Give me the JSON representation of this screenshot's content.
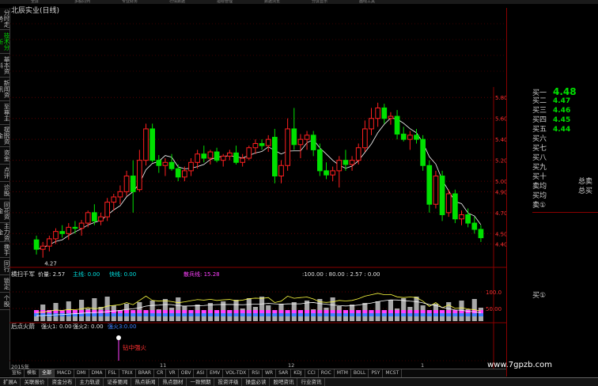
{
  "app": {
    "title": "北辰实业(日线)",
    "top_menu": [
      "全屏",
      "多股同列",
      "专业财务",
      "行情数据",
      "指标管理",
      "数据浏览",
      "分屏显示",
      "画线工具"
    ]
  },
  "left_sidebar": {
    "tabs": [
      {
        "label": "分时走势",
        "active": false
      },
      {
        "label": "技术分析",
        "active": true
      },
      {
        "label": "基本资料",
        "active": false
      },
      {
        "label": "新闻资讯",
        "active": false
      },
      {
        "label": "至尊主",
        "active": false
      },
      {
        "label": "摆脱资金",
        "active": false
      },
      {
        "label": "资金",
        "active": false
      },
      {
        "label": "点评",
        "active": false
      },
      {
        "label": "诊股",
        "active": false
      },
      {
        "label": "同花资金",
        "active": false
      },
      {
        "label": "主力资金",
        "active": false
      },
      {
        "label": "换手",
        "active": false
      },
      {
        "label": "同行",
        "active": false
      },
      {
        "label": "锁定",
        "active": false
      },
      {
        "label": "个股",
        "active": false
      }
    ]
  },
  "indicator_bar_1": {
    "name": "横扫千军",
    "fields": [
      "价量: 2.57",
      "主线: 0.00",
      "快线: 0.00",
      "散兵线: 15.28",
      ":100.00 : 80.00 : 2.57 : 0.00"
    ]
  },
  "indicator_bar_2": {
    "name": "后点火箭",
    "fields": [
      "强火1: 0.00",
      "强火2: 0.00",
      "强火3:0.00"
    ]
  },
  "annotations": {
    "low_price": "4.27",
    "signal_label": "钻中强火"
  },
  "price_axis": [
    "5.80",
    "5.60",
    "5.40",
    "5.20",
    "5.00",
    "4.90",
    "4.70",
    "4.50",
    "4.40"
  ],
  "sub_axis": [
    "100.0",
    "50.00"
  ],
  "right_panel": {
    "quotes": [
      {
        "label": "买一",
        "value": "4.48"
      },
      {
        "label": "买二",
        "value": "4.47"
      },
      {
        "label": "买三",
        "value": "4.46"
      },
      {
        "label": "买四",
        "value": "4.45"
      },
      {
        "label": "买五",
        "value": "4.44"
      },
      {
        "label": "买六",
        "value": ""
      },
      {
        "label": "买七",
        "value": ""
      },
      {
        "label": "买八",
        "value": ""
      },
      {
        "label": "买九",
        "value": ""
      },
      {
        "label": "买十",
        "value": ""
      },
      {
        "label": "卖均",
        "value": ""
      },
      {
        "label": "买均",
        "value": ""
      },
      {
        "label": "卖①",
        "value": ""
      }
    ],
    "side_labels": [
      "总卖",
      "总买"
    ],
    "sub_label": "买①"
  },
  "year_labels": [
    "2015年",
    "11",
    "12",
    "1"
  ],
  "bottom_tabs": [
    "宣标",
    "模板",
    "全部",
    "MACD",
    "DMI",
    "DMA",
    "FSL",
    "TRIX",
    "BRAR",
    "CR",
    "VR",
    "OBV",
    "ASI",
    "EMV",
    "VOL-TDX",
    "RSI",
    "WR",
    "SAR",
    "KDJ",
    "CCI",
    "ROC",
    "MTM",
    "BOLL",
    "PSY",
    "MCST"
  ],
  "status_bar": [
    "扩展A",
    "关联报价",
    "资金分布",
    "主力轨迹",
    "证券要闻",
    "热点新闻",
    "热点题材",
    "一致预期",
    "投资评级",
    "操盘必读",
    "股吧资讯",
    "行业资讯"
  ],
  "watermark": "www.7gpzb.com",
  "colors": {
    "up": "#ff2020",
    "down": "#00e000",
    "ma": "#ffffff",
    "grid": "#800000"
  },
  "chart_data": {
    "type": "candlestick",
    "title": "北辰实业(日线)",
    "ylim": [
      4.2,
      5.9
    ],
    "candles": [
      {
        "o": 4.44,
        "h": 4.48,
        "l": 4.3,
        "c": 4.35
      },
      {
        "o": 4.35,
        "h": 4.42,
        "l": 4.27,
        "c": 4.38
      },
      {
        "o": 4.38,
        "h": 4.48,
        "l": 4.33,
        "c": 4.45
      },
      {
        "o": 4.45,
        "h": 4.55,
        "l": 4.4,
        "c": 4.52
      },
      {
        "o": 4.52,
        "h": 4.58,
        "l": 4.46,
        "c": 4.5
      },
      {
        "o": 4.5,
        "h": 4.6,
        "l": 4.44,
        "c": 4.56
      },
      {
        "o": 4.56,
        "h": 4.62,
        "l": 4.5,
        "c": 4.55
      },
      {
        "o": 4.55,
        "h": 4.63,
        "l": 4.48,
        "c": 4.6
      },
      {
        "o": 4.6,
        "h": 4.72,
        "l": 4.56,
        "c": 4.7
      },
      {
        "o": 4.7,
        "h": 4.78,
        "l": 4.58,
        "c": 4.62
      },
      {
        "o": 4.62,
        "h": 4.7,
        "l": 4.58,
        "c": 4.66
      },
      {
        "o": 4.66,
        "h": 4.84,
        "l": 4.62,
        "c": 4.8
      },
      {
        "o": 4.8,
        "h": 4.88,
        "l": 4.72,
        "c": 4.85
      },
      {
        "o": 4.85,
        "h": 4.96,
        "l": 4.78,
        "c": 4.9
      },
      {
        "o": 4.9,
        "h": 5.1,
        "l": 4.86,
        "c": 5.05
      },
      {
        "o": 5.05,
        "h": 5.2,
        "l": 4.7,
        "c": 4.9
      },
      {
        "o": 4.92,
        "h": 5.3,
        "l": 4.9,
        "c": 5.2
      },
      {
        "o": 5.2,
        "h": 5.55,
        "l": 5.15,
        "c": 5.5
      },
      {
        "o": 5.5,
        "h": 5.55,
        "l": 5.18,
        "c": 5.2
      },
      {
        "o": 5.2,
        "h": 5.25,
        "l": 5.08,
        "c": 5.15
      },
      {
        "o": 5.15,
        "h": 5.22,
        "l": 5.05,
        "c": 5.18
      },
      {
        "o": 5.18,
        "h": 5.26,
        "l": 5.1,
        "c": 5.12
      },
      {
        "o": 5.12,
        "h": 5.16,
        "l": 5.0,
        "c": 5.04
      },
      {
        "o": 5.04,
        "h": 5.14,
        "l": 5.0,
        "c": 5.1
      },
      {
        "o": 5.1,
        "h": 5.22,
        "l": 5.05,
        "c": 5.18
      },
      {
        "o": 5.18,
        "h": 5.3,
        "l": 5.12,
        "c": 5.26
      },
      {
        "o": 5.26,
        "h": 5.34,
        "l": 5.18,
        "c": 5.22
      },
      {
        "o": 5.22,
        "h": 5.3,
        "l": 5.16,
        "c": 5.28
      },
      {
        "o": 5.28,
        "h": 5.32,
        "l": 5.18,
        "c": 5.2
      },
      {
        "o": 5.2,
        "h": 5.26,
        "l": 5.14,
        "c": 5.24
      },
      {
        "o": 5.24,
        "h": 5.3,
        "l": 5.2,
        "c": 5.27
      },
      {
        "o": 5.27,
        "h": 5.34,
        "l": 5.16,
        "c": 5.18
      },
      {
        "o": 5.18,
        "h": 5.26,
        "l": 5.14,
        "c": 5.22
      },
      {
        "o": 5.22,
        "h": 5.34,
        "l": 5.2,
        "c": 5.32
      },
      {
        "o": 5.32,
        "h": 5.4,
        "l": 5.26,
        "c": 5.36
      },
      {
        "o": 5.36,
        "h": 5.4,
        "l": 5.3,
        "c": 5.34
      },
      {
        "o": 5.34,
        "h": 5.44,
        "l": 5.28,
        "c": 5.4
      },
      {
        "o": 5.42,
        "h": 5.5,
        "l": 4.98,
        "c": 5.05
      },
      {
        "o": 5.05,
        "h": 5.2,
        "l": 4.98,
        "c": 5.15
      },
      {
        "o": 5.15,
        "h": 5.6,
        "l": 5.1,
        "c": 5.5
      },
      {
        "o": 5.5,
        "h": 5.7,
        "l": 5.3,
        "c": 5.35
      },
      {
        "o": 5.35,
        "h": 5.45,
        "l": 5.22,
        "c": 5.4
      },
      {
        "o": 5.4,
        "h": 5.48,
        "l": 5.3,
        "c": 5.44
      },
      {
        "o": 5.44,
        "h": 5.48,
        "l": 5.24,
        "c": 5.3
      },
      {
        "o": 5.3,
        "h": 5.36,
        "l": 5.05,
        "c": 5.1
      },
      {
        "o": 5.1,
        "h": 5.18,
        "l": 5.02,
        "c": 5.06
      },
      {
        "o": 5.06,
        "h": 5.14,
        "l": 5.0,
        "c": 5.1
      },
      {
        "o": 5.1,
        "h": 5.24,
        "l": 4.94,
        "c": 5.2
      },
      {
        "o": 5.2,
        "h": 5.3,
        "l": 5.1,
        "c": 5.16
      },
      {
        "o": 5.16,
        "h": 5.24,
        "l": 5.1,
        "c": 5.2
      },
      {
        "o": 5.2,
        "h": 5.36,
        "l": 5.16,
        "c": 5.32
      },
      {
        "o": 5.32,
        "h": 5.58,
        "l": 5.28,
        "c": 5.5
      },
      {
        "o": 5.5,
        "h": 5.7,
        "l": 5.44,
        "c": 5.6
      },
      {
        "o": 5.6,
        "h": 5.75,
        "l": 5.52,
        "c": 5.7
      },
      {
        "o": 5.7,
        "h": 5.74,
        "l": 5.55,
        "c": 5.6
      },
      {
        "o": 5.6,
        "h": 5.66,
        "l": 5.54,
        "c": 5.62
      },
      {
        "o": 5.62,
        "h": 5.68,
        "l": 5.4,
        "c": 5.45
      },
      {
        "o": 5.45,
        "h": 5.52,
        "l": 5.38,
        "c": 5.4
      },
      {
        "o": 5.4,
        "h": 5.48,
        "l": 5.3,
        "c": 5.44
      },
      {
        "o": 5.44,
        "h": 5.5,
        "l": 5.36,
        "c": 5.4
      },
      {
        "o": 5.4,
        "h": 5.44,
        "l": 5.1,
        "c": 5.15
      },
      {
        "o": 5.15,
        "h": 5.2,
        "l": 4.7,
        "c": 4.78
      },
      {
        "o": 4.78,
        "h": 5.1,
        "l": 4.74,
        "c": 5.05
      },
      {
        "o": 5.05,
        "h": 5.1,
        "l": 4.62,
        "c": 4.68
      },
      {
        "o": 4.7,
        "h": 4.92,
        "l": 4.66,
        "c": 4.88
      },
      {
        "o": 4.88,
        "h": 4.92,
        "l": 4.6,
        "c": 4.64
      },
      {
        "o": 4.64,
        "h": 4.72,
        "l": 4.58,
        "c": 4.68
      },
      {
        "o": 4.68,
        "h": 4.74,
        "l": 4.56,
        "c": 4.6
      },
      {
        "o": 4.6,
        "h": 4.66,
        "l": 4.5,
        "c": 4.54
      },
      {
        "o": 4.54,
        "h": 4.58,
        "l": 4.42,
        "c": 4.46
      }
    ]
  }
}
